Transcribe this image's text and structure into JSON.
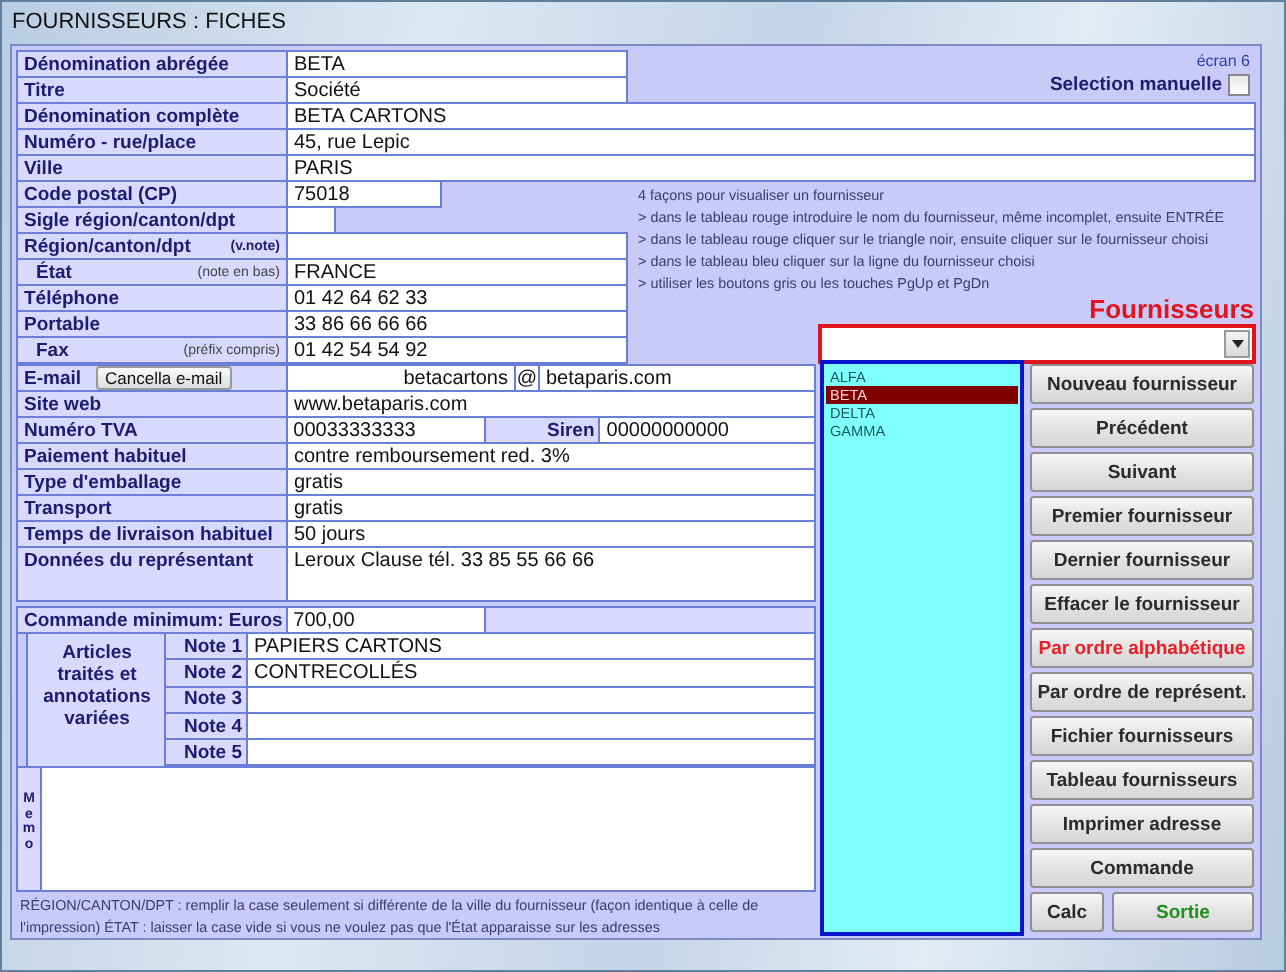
{
  "window": {
    "title": "FOURNISSEURS :  FICHES"
  },
  "screen_label": "écran 6",
  "manual_selection": {
    "label": "Selection manuelle",
    "checked": false
  },
  "header_fields": [
    {
      "label": "Dénomination abrégée",
      "value": "BETA"
    },
    {
      "label": "Titre",
      "value": "Société"
    }
  ],
  "address_fields": [
    {
      "label": "Dénomination complète",
      "value": "BETA CARTONS"
    },
    {
      "label": "Numéro - rue/place",
      "value": "45, rue Lepic"
    },
    {
      "label": "Ville",
      "value": "PARIS"
    }
  ],
  "contact_fields": [
    {
      "kind": "short",
      "label": "Code postal (CP)",
      "value": "75018"
    },
    {
      "kind": "tiny",
      "label": "Sigle région/canton/dpt"
    },
    {
      "kind": "text",
      "label": "Région/canton/dpt",
      "note": "(v.note)"
    },
    {
      "kind": "text",
      "label": "État",
      "note": "(note en bas)",
      "value": "FRANCE"
    },
    {
      "kind": "text",
      "label": "Téléphone",
      "value": "01 42 64 62 33"
    },
    {
      "kind": "text",
      "label": "Portable",
      "value": "33 86 66 66 66"
    },
    {
      "kind": "text",
      "label": "Fax",
      "note": "(préfix compris)",
      "value": "01 42 54 54 92"
    }
  ],
  "commercial_fields": [
    {
      "kind": "email",
      "label": "E-mail",
      "button": "Cancella e-mail",
      "user": "betacartons",
      "at": "@",
      "domain": "betaparis.com"
    },
    {
      "kind": "text",
      "label": "Site web",
      "value": "www.betaparis.com"
    },
    {
      "kind": "vat",
      "label": "Numéro TVA",
      "value": "00033333333",
      "second_label": "Siren",
      "second_value": "00000000000"
    },
    {
      "kind": "text",
      "label": "Paiement habituel",
      "value": "contre remboursement red. 3%"
    },
    {
      "kind": "text",
      "label": "Type d'emballage",
      "value": "gratis"
    },
    {
      "kind": "text",
      "label": "Transport",
      "value": "gratis"
    },
    {
      "kind": "text",
      "label": "Temps de livraison habituel",
      "value": "50 jours"
    },
    {
      "kind": "multiline",
      "label": "Données du représentant",
      "value": "Leroux Clause tél. 33 85 55 66 66"
    },
    {
      "kind": "short",
      "label": "Commande minimum: Euros",
      "value": "700,00"
    }
  ],
  "notes": {
    "title": "Articles traités et annotations variées",
    "items": [
      {
        "label": "Note 1",
        "value": "PAPIERS CARTONS"
      },
      {
        "label": "Note 2",
        "value": "CONTRECOLLÉS"
      },
      {
        "label": "Note 3"
      },
      {
        "label": "Note 4"
      },
      {
        "label": "Note 5"
      }
    ]
  },
  "memo": {
    "label": "Memo"
  },
  "footnote": "RÉGION/CANTON/DPT : remplir la case seulement si différente de la ville du fournisseur (façon identique à celle de l'impression)    ÉTAT : laisser la case vide si vous ne voulez pas que l'État apparaisse sur les adresses",
  "instructions": [
    "4 façons pour visualiser un fournisseur",
    "> dans le tableau rouge introduire le nom du fournisseur, même incomplet, ensuite ENTRÉE",
    "> dans le tableau rouge cliquer sur le triangle noir, ensuite cliquer sur le fournisseur choisi",
    "> dans le tableau bleu cliquer sur la ligne du fournisseur choisi",
    "> utiliser les boutons gris ou les touches PgUp et PgDn"
  ],
  "supplier_search": {
    "title": "Fournisseurs"
  },
  "suppliers": [
    {
      "name": "ALFA",
      "selected": false
    },
    {
      "name": "BETA",
      "selected": true
    },
    {
      "name": "DELTA",
      "selected": false
    },
    {
      "name": "GAMMA",
      "selected": false
    }
  ],
  "buttons": [
    {
      "label": "Nouveau fournisseur",
      "color": "#2b2b2b"
    },
    {
      "label": "Précédent",
      "color": "#2b2b2b"
    },
    {
      "label": "Suivant",
      "color": "#2b2b2b"
    },
    {
      "label": "Premier fournisseur",
      "color": "#2b2b2b"
    },
    {
      "label": "Dernier fournisseur",
      "color": "#2b2b2b"
    },
    {
      "label": "Effacer le fournisseur",
      "color": "#2b2b2b"
    },
    {
      "label": "Par ordre alphabétique",
      "color": "#e8202a"
    },
    {
      "label": "Par ordre de représent.",
      "color": "#2b2b2b"
    },
    {
      "label": "Fichier fournisseurs",
      "color": "#2b2b2b"
    },
    {
      "label": "Tableau fournisseurs",
      "color": "#2b2b2b"
    },
    {
      "label": "Imprimer adresse",
      "color": "#2b2b2b"
    },
    {
      "label": "Commande",
      "color": "#2b2b2b"
    }
  ],
  "bottom_buttons": [
    {
      "label": "Calc",
      "color": "#2b2b2b"
    },
    {
      "label": "Sortie",
      "color": "#1f8f1f"
    }
  ]
}
